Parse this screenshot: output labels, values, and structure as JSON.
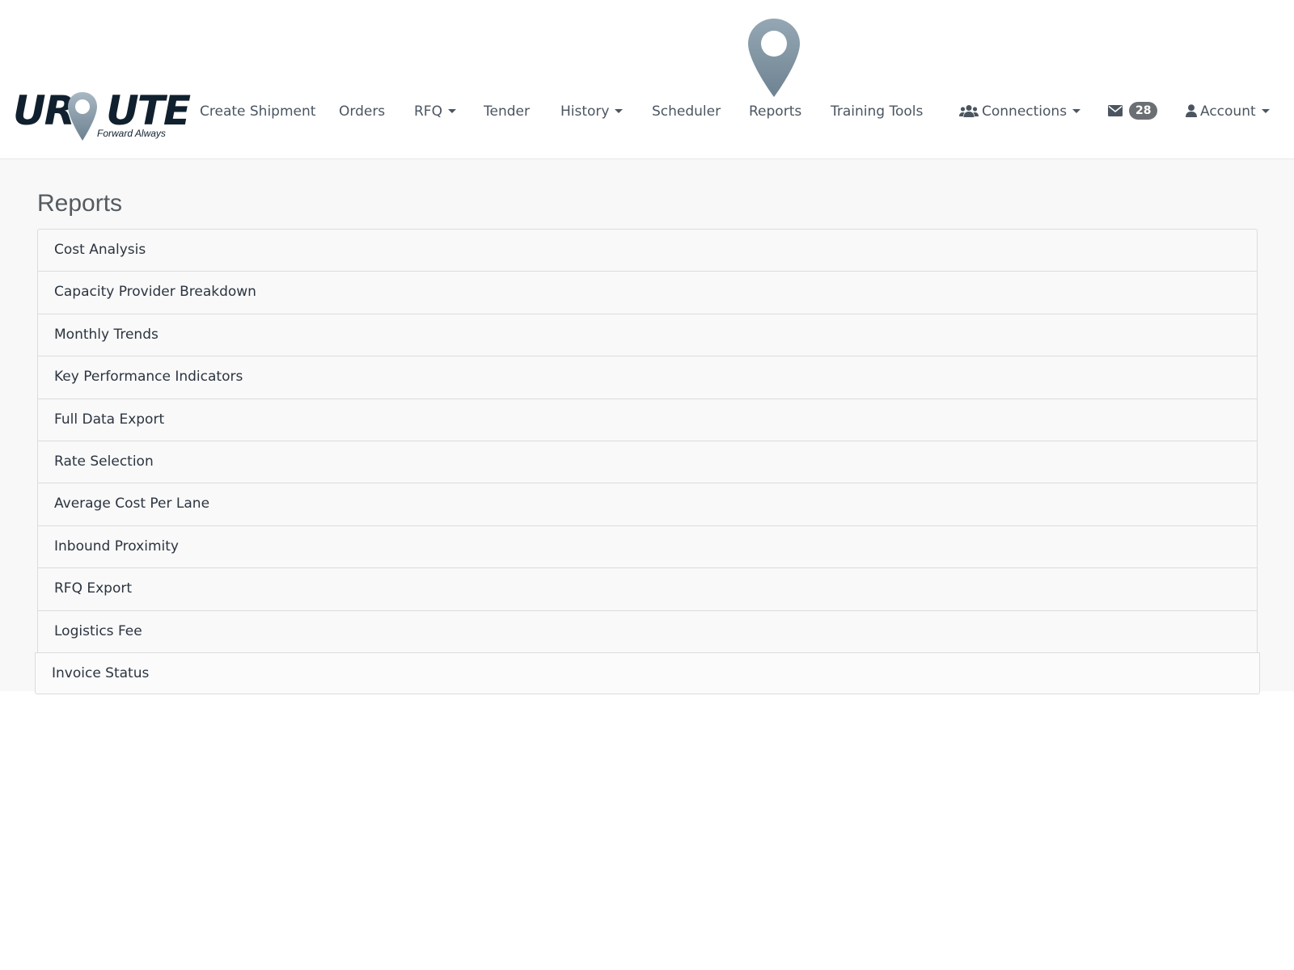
{
  "brand": {
    "logo_left": "UR",
    "logo_right": "UTE",
    "tagline": "Forward Always",
    "color": "#10202e",
    "pin_color": "#8a9ba8"
  },
  "nav": {
    "create_shipment": "Create Shipment",
    "orders": "Orders",
    "rfq": "RFQ",
    "tender": "Tender",
    "history": "History",
    "scheduler": "Scheduler",
    "reports": "Reports",
    "training_tools": "Training Tools",
    "connections": "Connections",
    "messages_count": "28",
    "account": "Account",
    "active_item": "Reports",
    "icons": {
      "connections": "users-icon",
      "messages": "envelope-icon",
      "account": "user-icon",
      "active": "map-pin-icon"
    }
  },
  "page": {
    "title": "Reports"
  },
  "reports": [
    {
      "label": "Cost Analysis"
    },
    {
      "label": "Capacity Provider Breakdown"
    },
    {
      "label": "Monthly Trends"
    },
    {
      "label": "Key Performance Indicators"
    },
    {
      "label": "Full Data Export"
    },
    {
      "label": "Rate Selection"
    },
    {
      "label": "Average Cost Per Lane"
    },
    {
      "label": "Inbound Proximity"
    },
    {
      "label": "RFQ Export"
    },
    {
      "label": "Logistics Fee"
    },
    {
      "label": "Invoice Status"
    }
  ]
}
